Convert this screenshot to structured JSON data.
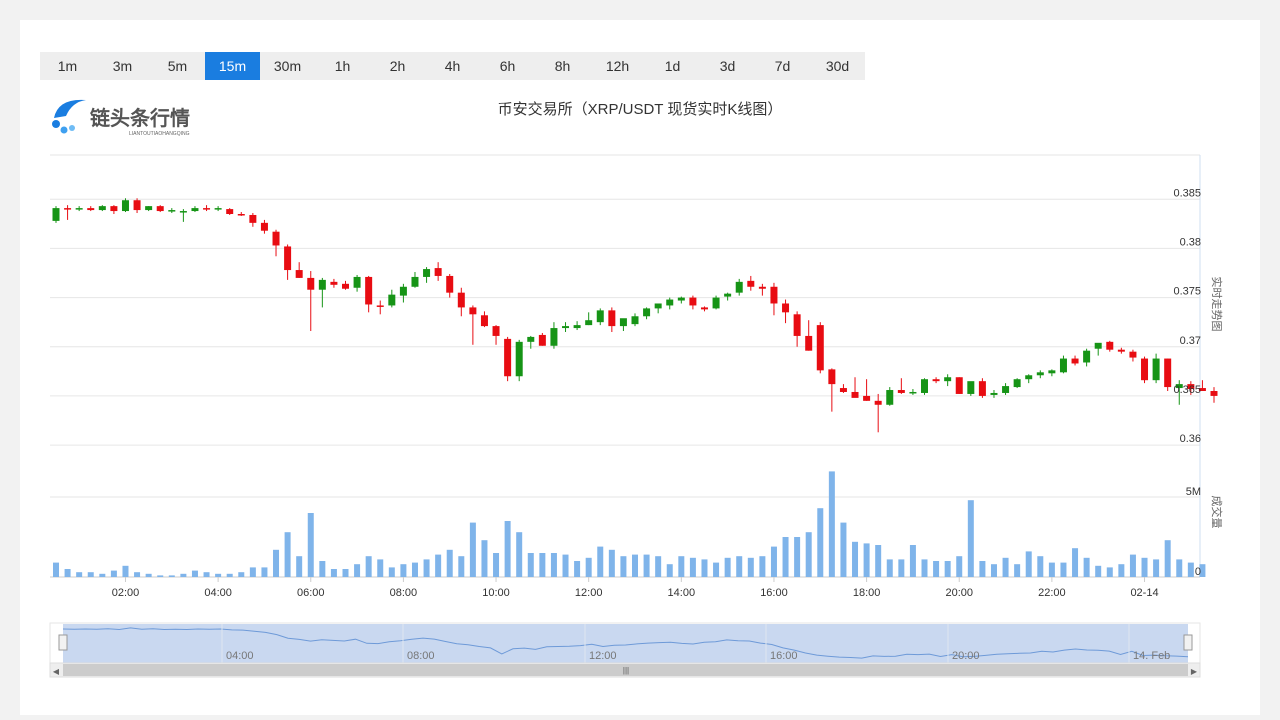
{
  "toolbar": {
    "intervals": [
      "1m",
      "3m",
      "5m",
      "15m",
      "30m",
      "1h",
      "2h",
      "4h",
      "6h",
      "8h",
      "12h",
      "1d",
      "3d",
      "7d",
      "30d"
    ],
    "active": "15m"
  },
  "logo": {
    "name": "链头条行情",
    "sub": "LIANTOUTIAOHANGQING"
  },
  "colors": {
    "up": "#169416",
    "down": "#e80c12",
    "volume": "#7fb4ea",
    "accent": "#1a7de0"
  },
  "chart_data": {
    "type": "candlestick",
    "title": "币安交易所（XRP/USDT 现货实时K线图）",
    "price_axis": {
      "label": "实时走势图",
      "ticks": [
        "0.385",
        "0.38",
        "0.375",
        "0.37",
        "0.365",
        "0.36"
      ],
      "ylim": [
        0.3595,
        0.3895
      ]
    },
    "volume_axis": {
      "label": "成交量",
      "ticks": [
        "5M",
        "0"
      ],
      "ylim": [
        0,
        7000000
      ]
    },
    "x_ticks": [
      "02:00",
      "04:00",
      "06:00",
      "08:00",
      "10:00",
      "12:00",
      "14:00",
      "16:00",
      "18:00",
      "20:00",
      "22:00",
      "02-14"
    ],
    "navigator_ticks": [
      "04:00",
      "08:00",
      "12:00",
      "16:00",
      "20:00",
      "14. Feb"
    ],
    "candles": [
      [
        0.3828,
        0.3843,
        0.3826,
        0.3841
      ],
      [
        0.3841,
        0.3844,
        0.3829,
        0.384
      ],
      [
        0.384,
        0.3843,
        0.3838,
        0.3841
      ],
      [
        0.3841,
        0.3843,
        0.3838,
        0.3839
      ],
      [
        0.3839,
        0.3844,
        0.3838,
        0.3843
      ],
      [
        0.3843,
        0.3844,
        0.3835,
        0.3838
      ],
      [
        0.3838,
        0.3851,
        0.3837,
        0.3849
      ],
      [
        0.3849,
        0.3851,
        0.3836,
        0.3839
      ],
      [
        0.3839,
        0.3843,
        0.3838,
        0.3843
      ],
      [
        0.3843,
        0.3844,
        0.3837,
        0.3838
      ],
      [
        0.3838,
        0.3841,
        0.3836,
        0.3839
      ],
      [
        0.3837,
        0.384,
        0.3827,
        0.3838
      ],
      [
        0.3838,
        0.3843,
        0.3837,
        0.3841
      ],
      [
        0.3841,
        0.3844,
        0.3838,
        0.384
      ],
      [
        0.384,
        0.3843,
        0.3838,
        0.3841
      ],
      [
        0.384,
        0.3841,
        0.3834,
        0.3835
      ],
      [
        0.3835,
        0.3837,
        0.3833,
        0.3834
      ],
      [
        0.3834,
        0.3836,
        0.3822,
        0.3826
      ],
      [
        0.3826,
        0.3829,
        0.3815,
        0.3818
      ],
      [
        0.3817,
        0.3819,
        0.3792,
        0.3803
      ],
      [
        0.3802,
        0.3804,
        0.3768,
        0.3778
      ],
      [
        0.3778,
        0.3786,
        0.377,
        0.377
      ],
      [
        0.377,
        0.3777,
        0.3716,
        0.3758
      ],
      [
        0.3758,
        0.377,
        0.374,
        0.3768
      ],
      [
        0.3766,
        0.3769,
        0.376,
        0.3763
      ],
      [
        0.3764,
        0.3767,
        0.3758,
        0.3759
      ],
      [
        0.376,
        0.3773,
        0.3756,
        0.3771
      ],
      [
        0.3771,
        0.3772,
        0.3735,
        0.3743
      ],
      [
        0.3742,
        0.3747,
        0.3733,
        0.3741
      ],
      [
        0.3742,
        0.3758,
        0.374,
        0.3753
      ],
      [
        0.3752,
        0.3764,
        0.3745,
        0.3761
      ],
      [
        0.3761,
        0.3776,
        0.376,
        0.3771
      ],
      [
        0.3771,
        0.3781,
        0.3765,
        0.3779
      ],
      [
        0.378,
        0.3786,
        0.3767,
        0.3772
      ],
      [
        0.3772,
        0.3774,
        0.375,
        0.3755
      ],
      [
        0.3755,
        0.376,
        0.3731,
        0.374
      ],
      [
        0.374,
        0.3742,
        0.3702,
        0.3733
      ],
      [
        0.3732,
        0.3736,
        0.372,
        0.3721
      ],
      [
        0.3721,
        0.3722,
        0.3702,
        0.3711
      ],
      [
        0.3708,
        0.371,
        0.3665,
        0.367
      ],
      [
        0.367,
        0.3707,
        0.3665,
        0.3705
      ],
      [
        0.3705,
        0.3711,
        0.3698,
        0.371
      ],
      [
        0.3712,
        0.3714,
        0.3701,
        0.3701
      ],
      [
        0.3701,
        0.3725,
        0.3698,
        0.3719
      ],
      [
        0.3719,
        0.3725,
        0.3715,
        0.3721
      ],
      [
        0.3719,
        0.3726,
        0.3717,
        0.3722
      ],
      [
        0.3722,
        0.3735,
        0.3722,
        0.3727
      ],
      [
        0.3725,
        0.3739,
        0.3722,
        0.3737
      ],
      [
        0.3737,
        0.374,
        0.3715,
        0.3721
      ],
      [
        0.3721,
        0.3728,
        0.3716,
        0.3729
      ],
      [
        0.3723,
        0.3734,
        0.3721,
        0.3731
      ],
      [
        0.3731,
        0.374,
        0.3728,
        0.3739
      ],
      [
        0.3739,
        0.3743,
        0.3734,
        0.3744
      ],
      [
        0.3742,
        0.375,
        0.3738,
        0.3748
      ],
      [
        0.3747,
        0.3751,
        0.3744,
        0.375
      ],
      [
        0.375,
        0.3752,
        0.3738,
        0.3742
      ],
      [
        0.374,
        0.3741,
        0.3736,
        0.3738
      ],
      [
        0.3739,
        0.3752,
        0.3738,
        0.375
      ],
      [
        0.3751,
        0.3755,
        0.3747,
        0.3754
      ],
      [
        0.3755,
        0.3769,
        0.3752,
        0.3766
      ],
      [
        0.3767,
        0.3772,
        0.3757,
        0.3761
      ],
      [
        0.3761,
        0.3764,
        0.3752,
        0.3759
      ],
      [
        0.3761,
        0.3765,
        0.3732,
        0.3744
      ],
      [
        0.3744,
        0.3748,
        0.3724,
        0.3735
      ],
      [
        0.3733,
        0.3736,
        0.37,
        0.3711
      ],
      [
        0.3711,
        0.3727,
        0.3696,
        0.3696
      ],
      [
        0.3722,
        0.3725,
        0.3673,
        0.3676
      ],
      [
        0.3677,
        0.3678,
        0.3634,
        0.3662
      ],
      [
        0.3658,
        0.3662,
        0.3653,
        0.3654
      ],
      [
        0.3654,
        0.3669,
        0.365,
        0.3648
      ],
      [
        0.365,
        0.3667,
        0.3645,
        0.3645
      ],
      [
        0.3645,
        0.3652,
        0.3613,
        0.3641
      ],
      [
        0.3641,
        0.3659,
        0.364,
        0.3656
      ],
      [
        0.3656,
        0.3668,
        0.3652,
        0.3653
      ],
      [
        0.3653,
        0.3657,
        0.3651,
        0.3654
      ],
      [
        0.3653,
        0.3668,
        0.3651,
        0.3667
      ],
      [
        0.3667,
        0.3669,
        0.3663,
        0.3665
      ],
      [
        0.3665,
        0.3672,
        0.366,
        0.3669
      ],
      [
        0.3669,
        0.3669,
        0.3652,
        0.3652
      ],
      [
        0.3652,
        0.3662,
        0.365,
        0.3665
      ],
      [
        0.3665,
        0.3668,
        0.3648,
        0.365
      ],
      [
        0.3651,
        0.3656,
        0.3648,
        0.3653
      ],
      [
        0.3653,
        0.3663,
        0.3651,
        0.366
      ],
      [
        0.3659,
        0.3668,
        0.3658,
        0.3667
      ],
      [
        0.3667,
        0.3672,
        0.3663,
        0.3671
      ],
      [
        0.3671,
        0.3676,
        0.3668,
        0.3674
      ],
      [
        0.3673,
        0.3677,
        0.367,
        0.3676
      ],
      [
        0.3674,
        0.3691,
        0.3673,
        0.3688
      ],
      [
        0.3688,
        0.3691,
        0.3681,
        0.3683
      ],
      [
        0.3684,
        0.3698,
        0.368,
        0.3696
      ],
      [
        0.3698,
        0.3702,
        0.3691,
        0.3704
      ],
      [
        0.3705,
        0.3706,
        0.3695,
        0.3697
      ],
      [
        0.3697,
        0.3699,
        0.3693,
        0.3695
      ],
      [
        0.3695,
        0.3697,
        0.3685,
        0.3689
      ],
      [
        0.3688,
        0.369,
        0.3663,
        0.3666
      ],
      [
        0.3666,
        0.3693,
        0.3663,
        0.3688
      ],
      [
        0.3688,
        0.3688,
        0.3655,
        0.3659
      ],
      [
        0.3658,
        0.3666,
        0.3641,
        0.3662
      ],
      [
        0.3662,
        0.3665,
        0.3651,
        0.3657
      ],
      [
        0.3658,
        0.3666,
        0.3656,
        0.3655
      ],
      [
        0.3655,
        0.3659,
        0.3643,
        0.365
      ]
    ],
    "volume_millions": [
      0.9,
      0.5,
      0.3,
      0.3,
      0.2,
      0.4,
      0.7,
      0.3,
      0.2,
      0.1,
      0.1,
      0.2,
      0.4,
      0.3,
      0.2,
      0.2,
      0.3,
      0.6,
      0.6,
      1.7,
      2.8,
      1.3,
      4.0,
      1.0,
      0.5,
      0.5,
      0.8,
      1.3,
      1.1,
      0.6,
      0.8,
      0.9,
      1.1,
      1.4,
      1.7,
      1.3,
      3.4,
      2.3,
      1.5,
      3.5,
      2.8,
      1.5,
      1.5,
      1.5,
      1.4,
      1.0,
      1.2,
      1.9,
      1.7,
      1.3,
      1.4,
      1.4,
      1.3,
      0.8,
      1.3,
      1.2,
      1.1,
      0.9,
      1.2,
      1.3,
      1.2,
      1.3,
      1.9,
      2.5,
      2.5,
      2.8,
      4.3,
      6.6,
      3.4,
      2.2,
      2.1,
      2.0,
      1.1,
      1.1,
      2.0,
      1.1,
      1.0,
      1.0,
      1.3,
      4.8,
      1.0,
      0.8,
      1.2,
      0.8,
      1.6,
      1.3,
      0.9,
      0.9,
      1.8,
      1.2,
      0.7,
      0.6,
      0.8,
      1.4,
      1.2,
      1.1,
      2.3,
      1.1,
      0.9,
      0.8
    ]
  }
}
